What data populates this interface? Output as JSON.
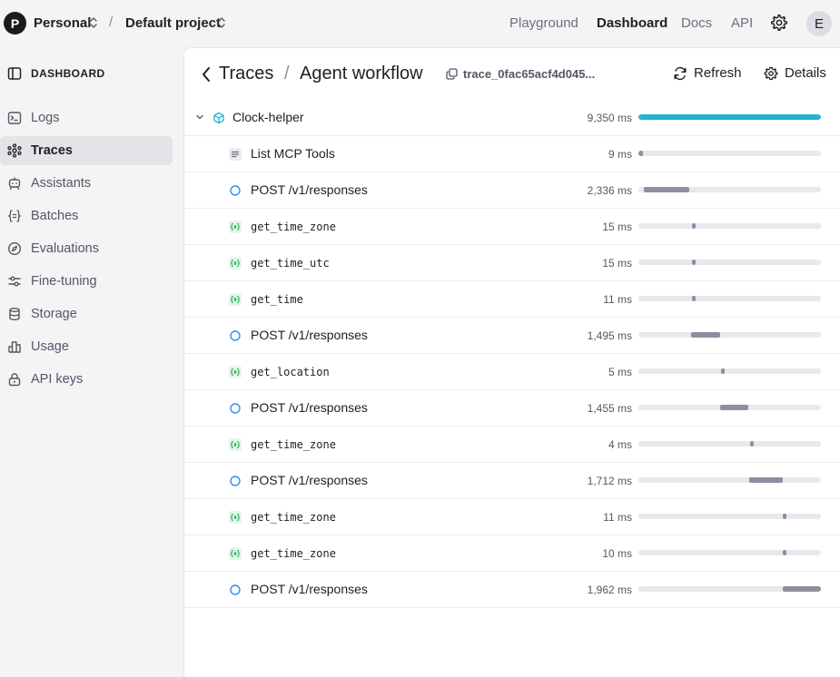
{
  "topbar": {
    "org_initial": "P",
    "org_name": "Personal",
    "separator": "/",
    "project_name": "Default project",
    "nav": [
      "Playground",
      "Dashboard",
      "Docs",
      "API"
    ],
    "active_nav": "Dashboard",
    "settings_icon": "gear-icon",
    "user_initial": "E"
  },
  "sidebar": {
    "heading": "DASHBOARD",
    "items": [
      {
        "label": "Logs",
        "icon": "terminal-icon"
      },
      {
        "label": "Traces",
        "icon": "traces-icon",
        "active": true
      },
      {
        "label": "Assistants",
        "icon": "robot-icon"
      },
      {
        "label": "Batches",
        "icon": "braces-icon"
      },
      {
        "label": "Evaluations",
        "icon": "compass-icon"
      },
      {
        "label": "Fine-tuning",
        "icon": "sliders-icon"
      },
      {
        "label": "Storage",
        "icon": "database-icon"
      },
      {
        "label": "Usage",
        "icon": "bar-chart-icon"
      },
      {
        "label": "API keys",
        "icon": "lock-icon"
      }
    ]
  },
  "header": {
    "breadcrumb_root": "Traces",
    "separator": "/",
    "title": "Agent workflow",
    "trace_id": "trace_0fac65acf4d045...",
    "refresh_label": "Refresh",
    "details_label": "Details"
  },
  "timeline": {
    "total_ms": 9350,
    "rows": [
      {
        "name": "Clock-helper",
        "type": "agent",
        "duration": "9,350 ms",
        "start": 0,
        "span": 1.0
      },
      {
        "name": "List MCP Tools",
        "type": "list",
        "duration": "9 ms",
        "start": 0,
        "span": 0.025
      },
      {
        "name": "POST /v1/responses",
        "type": "response",
        "duration": "2,336 ms",
        "start": 0.03,
        "span": 0.25
      },
      {
        "name": "get_time_zone",
        "type": "function",
        "duration": "15 ms",
        "start": 0.295,
        "span": 0.02
      },
      {
        "name": "get_time_utc",
        "type": "function",
        "duration": "15 ms",
        "start": 0.295,
        "span": 0.02
      },
      {
        "name": "get_time",
        "type": "function",
        "duration": "11 ms",
        "start": 0.295,
        "span": 0.02
      },
      {
        "name": "POST /v1/responses",
        "type": "response",
        "duration": "1,495 ms",
        "start": 0.29,
        "span": 0.16
      },
      {
        "name": "get_location",
        "type": "function",
        "duration": "5 ms",
        "start": 0.455,
        "span": 0.02
      },
      {
        "name": "POST /v1/responses",
        "type": "response",
        "duration": "1,455 ms",
        "start": 0.45,
        "span": 0.155
      },
      {
        "name": "get_time_zone",
        "type": "function",
        "duration": "4 ms",
        "start": 0.61,
        "span": 0.02
      },
      {
        "name": "POST /v1/responses",
        "type": "response",
        "duration": "1,712 ms",
        "start": 0.605,
        "span": 0.183
      },
      {
        "name": "get_time_zone",
        "type": "function",
        "duration": "11 ms",
        "start": 0.79,
        "span": 0.02
      },
      {
        "name": "get_time_zone",
        "type": "function",
        "duration": "10 ms",
        "start": 0.79,
        "span": 0.02
      },
      {
        "name": "POST /v1/responses",
        "type": "response",
        "duration": "1,962 ms",
        "start": 0.79,
        "span": 0.21
      }
    ]
  }
}
